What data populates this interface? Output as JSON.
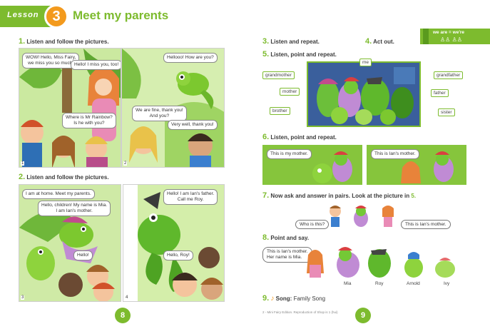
{
  "header": {
    "lesson_word": "Lesson",
    "lesson_number": "3",
    "title": "Meet my parents"
  },
  "sections": {
    "s1": {
      "num": "1.",
      "text": "Listen and follow the pictures."
    },
    "s2": {
      "num": "2.",
      "text": "Listen and follow the pictures."
    },
    "s3": {
      "num": "3.",
      "text": "Listen and repeat."
    },
    "s4": {
      "num": "4.",
      "text": "Act out."
    },
    "s5": {
      "num": "5.",
      "text": "Listen, point and repeat."
    },
    "s6": {
      "num": "6.",
      "text": "Listen, point and repeat."
    },
    "s7": {
      "num": "7.",
      "text": "Now ask and answer in pairs. Look at the picture in",
      "ref": "5."
    },
    "s8": {
      "num": "8.",
      "text": "Point and say."
    },
    "s9": {
      "num": "9.",
      "text": "Song:",
      "song": "Family Song"
    }
  },
  "story": {
    "p1": {
      "num": "1",
      "b1": "WOW! Hello, Miss Fairy,",
      "b1b": "we miss you so much!",
      "b2": "Hello! I miss you, too!",
      "b3": "Where is Mr Rainbow?",
      "b3b": "Is he with you?"
    },
    "p2": {
      "num": "2",
      "b1": "Hellooo! How are you?",
      "b2": "We are fine, thank you!",
      "b2b": "And you?",
      "b3": "Very well, thank you!"
    },
    "p3": {
      "num": "3",
      "b1": "I am at home. Meet my parents.",
      "b2": "Hello, children! My name is Mia.",
      "b2b": "I am Ian's mother.",
      "b3": "Hello!"
    },
    "p4": {
      "num": "4",
      "b1": "Hello! I am Ian's father.",
      "b1b": "Call me Roy.",
      "b2": "Hello, Roy!"
    }
  },
  "grammar_box": {
    "text": "we are = we're"
  },
  "family_labels": {
    "me": "me",
    "grandmother": "grandmother",
    "grandfather": "grandfather",
    "mother": "mother",
    "father": "father",
    "brother": "brother",
    "sister": "sister"
  },
  "ex6": {
    "b1": "This is my mother.",
    "b2": "This is Ian's mother."
  },
  "ex7": {
    "q": "Who is this?",
    "a": "This is Ian's mother."
  },
  "ex8": {
    "b1": "This is Ian's mother.",
    "b1b": "Her name is Mia.",
    "names": [
      "Mia",
      "Roy",
      "Arnold",
      "Ivy"
    ]
  },
  "pages": {
    "left": "8",
    "right": "9"
  },
  "footer": "2 - Mini Fairy Edition. Reproduction of Shop is 1 (hui)",
  "colors": {
    "accent": "#7dbb2e",
    "orange": "#f39a1d"
  }
}
